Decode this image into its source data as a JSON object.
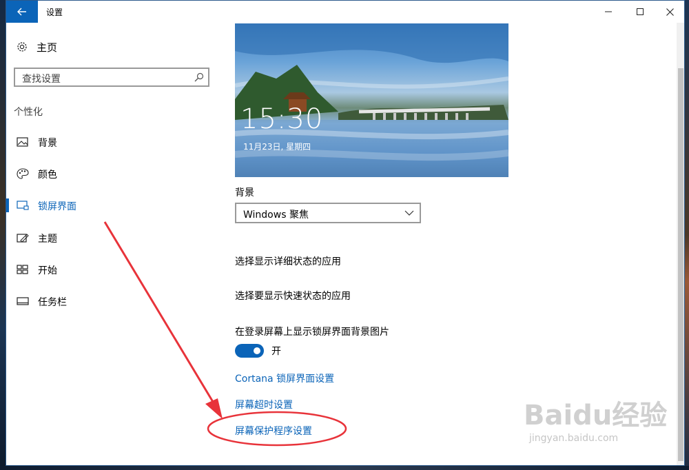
{
  "window": {
    "title": "设置",
    "back_icon": "arrow-left-icon",
    "controls": [
      "minimize-icon",
      "maximize-icon",
      "close-icon"
    ]
  },
  "sidebar": {
    "home_label": "主页",
    "search_placeholder": "查找设置",
    "section_title": "个性化",
    "items": [
      {
        "label": "背景",
        "icon": "image-icon",
        "active": false
      },
      {
        "label": "颜色",
        "icon": "palette-icon",
        "active": false
      },
      {
        "label": "锁屏界面",
        "icon": "lock-screen-icon",
        "active": true
      },
      {
        "label": "主题",
        "icon": "theme-icon",
        "active": false
      },
      {
        "label": "开始",
        "icon": "start-icon",
        "active": false
      },
      {
        "label": "任务栏",
        "icon": "taskbar-icon",
        "active": false
      }
    ]
  },
  "main": {
    "preview": {
      "time": "15:30",
      "date": "11月23日, 星期四"
    },
    "background_label": "背景",
    "background_select_value": "Windows 聚焦",
    "detailed_status_label": "选择显示详细状态的应用",
    "quick_status_label": "选择要显示快速状态的应用",
    "show_bg_on_signin_label": "在登录屏幕上显示锁屏界面背景图片",
    "toggle_state": "开",
    "toggle_on": true,
    "links": {
      "cortana": "Cortana 锁屏界面设置",
      "screen_timeout": "屏幕超时设置",
      "screensaver": "屏幕保护程序设置"
    }
  },
  "colors": {
    "accent": "#0b64b8",
    "annotation": "#e8333a"
  },
  "watermark": {
    "logo": "Baidu经验",
    "url": "jingyan.baidu.com"
  }
}
